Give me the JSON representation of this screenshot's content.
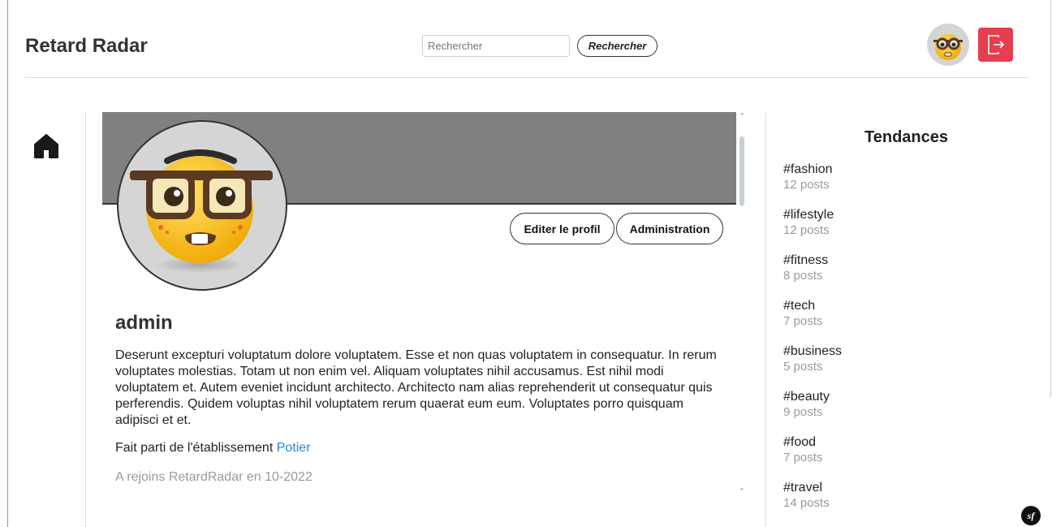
{
  "header": {
    "brand": "Retard Radar",
    "search_placeholder": "Rechercher",
    "search_button": "Rechercher"
  },
  "profile": {
    "edit_button": "Editer le profil",
    "admin_button": "Administration",
    "username": "admin",
    "bio": "Deserunt excepturi voluptatum dolore voluptatem. Esse et non quas voluptatem in consequatur. In rerum voluptates molestias. Totam ut non enim vel. Aliquam voluptates nihil accusamus. Est nihil modi voluptatem et. Autem eveniet incidunt architecto. Architecto nam alias reprehenderit ut consequatur quis perferendis. Quidem voluptas nihil voluptatem rerum quaerat eum eum. Voluptates porro quisquam adipisci et et.",
    "establishment_prefix": "Fait parti de l'établissement",
    "establishment_name": "Potier",
    "joined": "A rejoins RetardRadar en 10-2022"
  },
  "trends": {
    "title": "Tendances",
    "items": [
      {
        "tag": "#fashion",
        "count": "12 posts"
      },
      {
        "tag": "#lifestyle",
        "count": "12 posts"
      },
      {
        "tag": "#fitness",
        "count": "8 posts"
      },
      {
        "tag": "#tech",
        "count": "7 posts"
      },
      {
        "tag": "#business",
        "count": "5 posts"
      },
      {
        "tag": "#beauty",
        "count": "9 posts"
      },
      {
        "tag": "#food",
        "count": "7 posts"
      },
      {
        "tag": "#travel",
        "count": "14 posts"
      }
    ]
  },
  "icons": {
    "home": "home-icon",
    "logout": "logout-icon",
    "avatar": "nerd-face-emoji",
    "debug": "symfony-icon"
  },
  "colors": {
    "logout_bg": "#e53e4f",
    "cover_bg": "#808080",
    "link": "#1e88e5",
    "muted": "#9a9a9a"
  }
}
